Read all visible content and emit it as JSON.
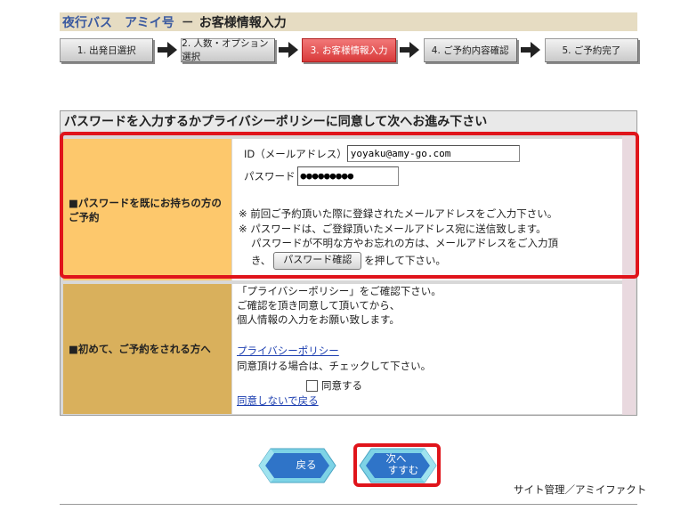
{
  "header": {
    "brand": "夜行バス　アミイ号",
    "separator": "－",
    "page_title": "お客様情報入力"
  },
  "steps": [
    {
      "label": "1. 出発日選択",
      "active": false
    },
    {
      "label": "2. 人数・オプション選択",
      "active": false
    },
    {
      "label": "3. お客様情報入力",
      "active": true
    },
    {
      "label": "4. ご予約内容確認",
      "active": false
    },
    {
      "label": "5. ご予約完了",
      "active": false
    }
  ],
  "form": {
    "heading": "パスワードを入力するかプライバシーポリシーに同意して次へお進み下さい",
    "existing": {
      "label": "■パスワードを既にお持ちの方のご予約",
      "id_label": "ID（メールアドレス）",
      "id_value": "yoyaku@amy-go.com",
      "password_label": "パスワード",
      "password_value": "●●●●●●●●●",
      "note1": "※ 前回ご予約頂いた際に登録されたメールアドレスをご入力下さい。",
      "note2": "※ パスワードは、ご登録頂いたメールアドレス宛に送信致します。",
      "note3": "パスワードが不明な方やお忘れの方は、メールアドレスをご入力頂",
      "note4_pre": "き、",
      "confirm_button": "パスワード確認",
      "note4_post": "を押して下さい。"
    },
    "first_time": {
      "label": "■初めて、ご予約をされる方へ",
      "line1": "「プライバシーポリシー」をご確認下さい。",
      "line2": "ご確認を頂き同意して頂いてから、",
      "line3": "個人情報の入力をお願い致します。",
      "policy_link": "プライバシーポリシー",
      "check_note": "同意頂ける場合は、チェックして下さい。",
      "agree_label": "同意する",
      "agree_checked": false,
      "disagree_link": "同意しないで戻る"
    }
  },
  "buttons": {
    "back": "戻る",
    "next_line1": "次へ",
    "next_line2": "すすむ"
  },
  "footer": {
    "text": "サイト管理／アミイファクト"
  }
}
